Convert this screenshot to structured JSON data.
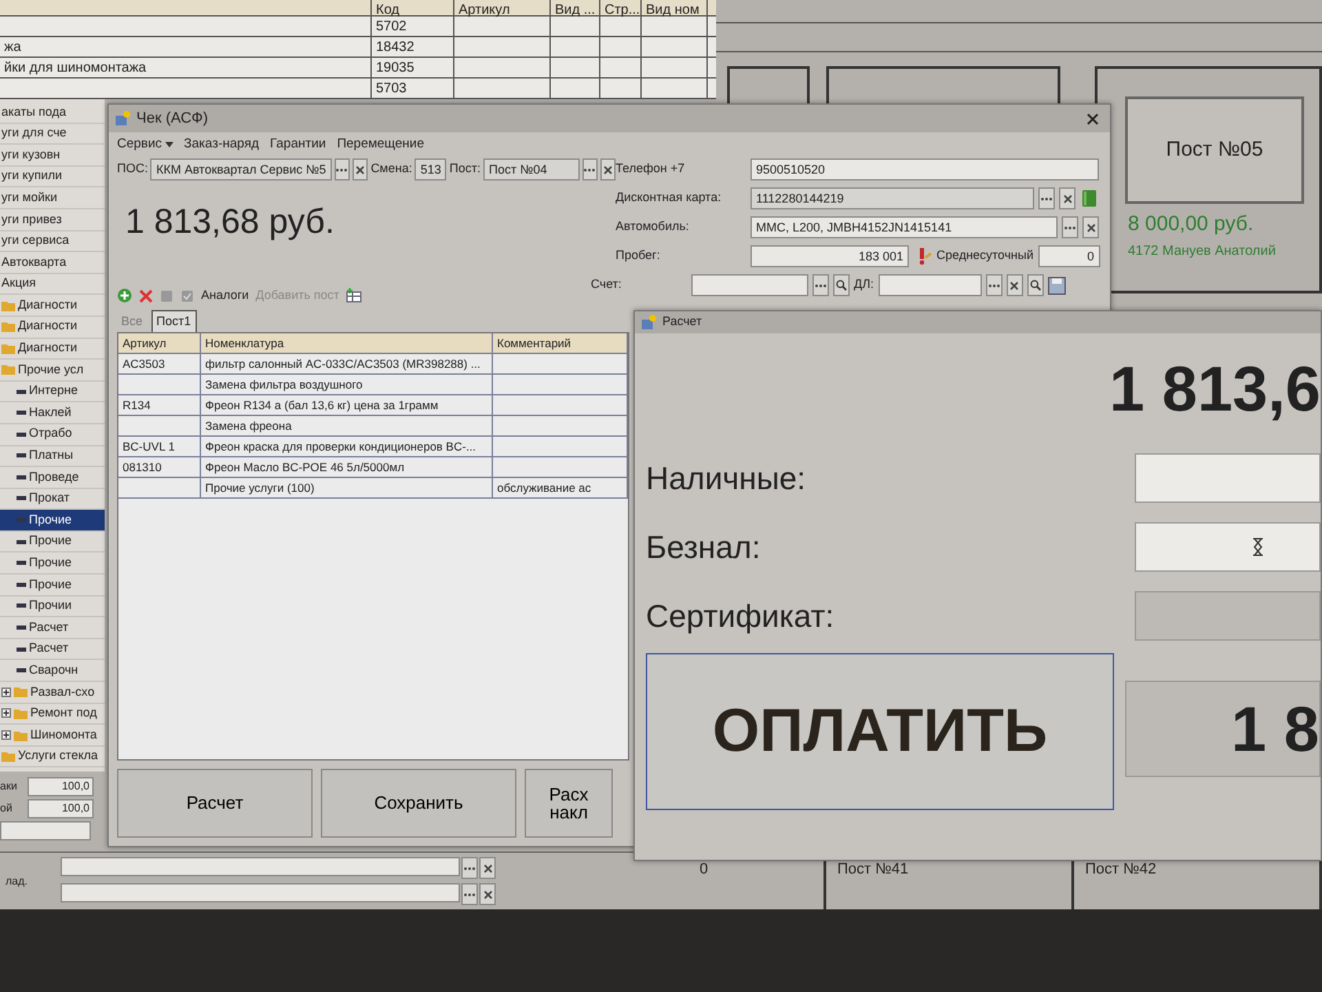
{
  "background": {
    "table": {
      "columns": [
        "Код",
        "Артикул",
        "Вид ...",
        "Стр...",
        "Вид ном"
      ],
      "rows": [
        {
          "code": "5702"
        },
        {
          "name": "жа",
          "code": "18432"
        },
        {
          "name": "йки для шиномонтажа",
          "code": "19035"
        },
        {
          "code": "5703"
        }
      ]
    },
    "tree": [
      {
        "label": "акаты пода",
        "kind": "row",
        "selected": false
      },
      {
        "label": "уги для сче",
        "kind": "row",
        "selected": false
      },
      {
        "label": "уги кузовн",
        "kind": "row",
        "selected": false
      },
      {
        "label": "уги купили",
        "kind": "row",
        "selected": false
      },
      {
        "label": "уги мойки",
        "kind": "row",
        "selected": false
      },
      {
        "label": "уги привез",
        "kind": "row",
        "selected": false
      },
      {
        "label": "уги сервиса",
        "kind": "row",
        "selected": false
      },
      {
        "label": "Автокварта",
        "kind": "row",
        "selected": false
      },
      {
        "label": "Акция",
        "kind": "row",
        "selected": false
      },
      {
        "label": "Диагности",
        "kind": "folder",
        "selected": false
      },
      {
        "label": "Диагности",
        "kind": "folder",
        "selected": false
      },
      {
        "label": "Диагности",
        "kind": "folder",
        "selected": false
      },
      {
        "label": "Прочие усл",
        "kind": "folder",
        "selected": false,
        "children": [
          {
            "label": "Интерне",
            "kind": "leaf",
            "selected": false
          },
          {
            "label": "Наклей",
            "kind": "leaf",
            "selected": false
          },
          {
            "label": "Отрабо",
            "kind": "leaf",
            "selected": false
          },
          {
            "label": "Платны",
            "kind": "leaf",
            "selected": false
          },
          {
            "label": "Проведе",
            "kind": "leaf",
            "selected": false
          },
          {
            "label": "Прокат",
            "kind": "leaf",
            "selected": false
          },
          {
            "label": "Прочие",
            "kind": "leaf",
            "selected": true
          },
          {
            "label": "Прочие",
            "kind": "leaf",
            "selected": false
          },
          {
            "label": "Прочие",
            "kind": "leaf",
            "selected": false
          },
          {
            "label": "Прочие",
            "kind": "leaf",
            "selected": false
          },
          {
            "label": "Прочии",
            "kind": "leaf",
            "selected": false
          },
          {
            "label": "Расчет",
            "kind": "leaf",
            "selected": false
          },
          {
            "label": "Расчет",
            "kind": "leaf",
            "selected": false
          },
          {
            "label": "Сварочн",
            "kind": "leaf",
            "selected": false
          }
        ]
      },
      {
        "label": "Развал-схо",
        "kind": "folder",
        "selected": false,
        "expanded": false
      },
      {
        "label": "Ремонт под",
        "kind": "folder",
        "selected": false,
        "expanded": false
      },
      {
        "label": "Шиномонта",
        "kind": "folder",
        "selected": false,
        "expanded": false
      },
      {
        "label": "Услуги стекла",
        "kind": "folder",
        "selected": false
      }
    ],
    "fields": [
      {
        "label": "аки",
        "value": "100,0"
      },
      {
        "label": "ой",
        "value": "100,0"
      }
    ],
    "lookup": {
      "label": "лад."
    },
    "post_card": {
      "title": "Пост №05",
      "amount": "8 000,00 руб.",
      "master": "4172 Мануев Анатолий"
    },
    "post_strip": [
      {
        "label": "0"
      },
      {
        "label": "Пост №41"
      },
      {
        "label": "Пост №42"
      }
    ]
  },
  "check_window": {
    "title": "Чек (АСФ)",
    "menu": [
      {
        "label": "Сервис",
        "dropdown": true
      },
      {
        "label": "Заказ-наряд",
        "dropdown": false
      },
      {
        "label": "Гарантии",
        "dropdown": false
      },
      {
        "label": "Перемещение",
        "dropdown": false
      }
    ],
    "pos": {
      "label": "ПОС:",
      "value": "ККМ Автоквартал Сервис №5"
    },
    "shift": {
      "label": "Смена:",
      "value": "513"
    },
    "post": {
      "label": "Пост:",
      "value": "Пост №04"
    },
    "total": "1 813,68 руб.",
    "phone": {
      "label": "Телефон +7",
      "value": "9500510520"
    },
    "discount_card": {
      "label": "Дисконтная карта:",
      "value": "1112280144219"
    },
    "car": {
      "label": "Автомобиль:",
      "value": "MMC, L200, JMBH4152JN1415141"
    },
    "mileage": {
      "label": "Пробег:",
      "value": "183 001"
    },
    "daily": {
      "label": "Среднесуточный",
      "value": "0"
    },
    "invoice": {
      "label": "Счет:"
    },
    "dl": {
      "label": "ДЛ:"
    },
    "toolbar": [
      {
        "label": "Аналоги",
        "disabled": false
      },
      {
        "label": "Добавить пост",
        "disabled": true
      }
    ],
    "tabs": [
      {
        "label": "Все",
        "selected": false
      },
      {
        "label": "Пост1",
        "selected": true
      }
    ],
    "table": {
      "columns": [
        "Артикул",
        "Номенклатура",
        "Комментарий"
      ],
      "rows": [
        {
          "article": "AC3503",
          "name": "фильтр салонный AC-033C/AC3503 (MR398288) ..."
        },
        {
          "name": "Замена фильтра воздушного"
        },
        {
          "article": "R134",
          "name": "Фреон R134 a (бал 13,6 кг) цена за 1грамм"
        },
        {
          "name": "Замена фреона"
        },
        {
          "article": "BC-UVL 1",
          "name": "Фреон краска для проверки кондиционеров BC-..."
        },
        {
          "article": "081310",
          "name": "Фреон Масло BC-POE 46 5л/5000мл"
        },
        {
          "name": "Прочие услуги (100)",
          "comment": "обслуживание ас"
        }
      ]
    },
    "buttons": [
      {
        "label": "Расчет"
      },
      {
        "label": "Сохранить"
      },
      {
        "label": "Расх накл"
      }
    ]
  },
  "payment_window": {
    "title": "Расчет",
    "total": "1 813,6",
    "fields": [
      {
        "label": "Наличные:",
        "disabled": false
      },
      {
        "label": "Безнал:",
        "disabled": false
      },
      {
        "label": "Сертификат:",
        "disabled": true
      }
    ],
    "pay_button": "ОПЛАТИТЬ",
    "remaining": "1 8"
  }
}
